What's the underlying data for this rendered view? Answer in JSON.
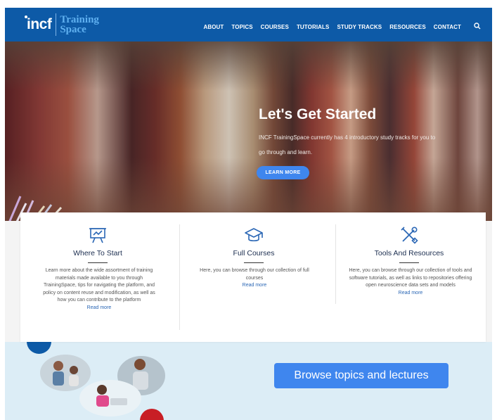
{
  "nav": {
    "logo_incf": "incf",
    "logo_training": "Training",
    "logo_space": "Space",
    "items": [
      {
        "label": "ABOUT"
      },
      {
        "label": "TOPICS"
      },
      {
        "label": "COURSES"
      },
      {
        "label": "TUTORIALS"
      },
      {
        "label": "STUDY TRACKS"
      },
      {
        "label": "RESOURCES"
      },
      {
        "label": "CONTACT"
      }
    ]
  },
  "hero": {
    "title": "Let's Get Started",
    "text": "INCF TrainingSpace currently has 4 introductory study tracks for you to go through and learn.",
    "button_label": "LEARN MORE"
  },
  "cards": [
    {
      "icon": "presentation-board-icon",
      "title": "Where To Start",
      "text": "Learn more about the wide assortment of training materials made available to you through TrainingSpace, tips for navigating the platform, and policy on content reuse and modification, as well as how you can contribute to the platform",
      "link": "Read more"
    },
    {
      "icon": "graduation-cap-icon",
      "title": "Full Courses",
      "text": "Here, you can browse through our collection of full courses",
      "link": "Read more"
    },
    {
      "icon": "tools-icon",
      "title": "Tools And Resources",
      "text": "Here, you can browse through our collection of tools and software tutorials, as well as links to repositories offering open neuroscience data sets and models",
      "link": "Read more"
    }
  ],
  "browse": {
    "button_label": "Browse topics and lectures"
  },
  "colors": {
    "nav_bg": "#0d5aa7",
    "accent_blue": "#3f86ee",
    "strip_bg": "#dcedf6",
    "dot_red": "#c81e25"
  }
}
